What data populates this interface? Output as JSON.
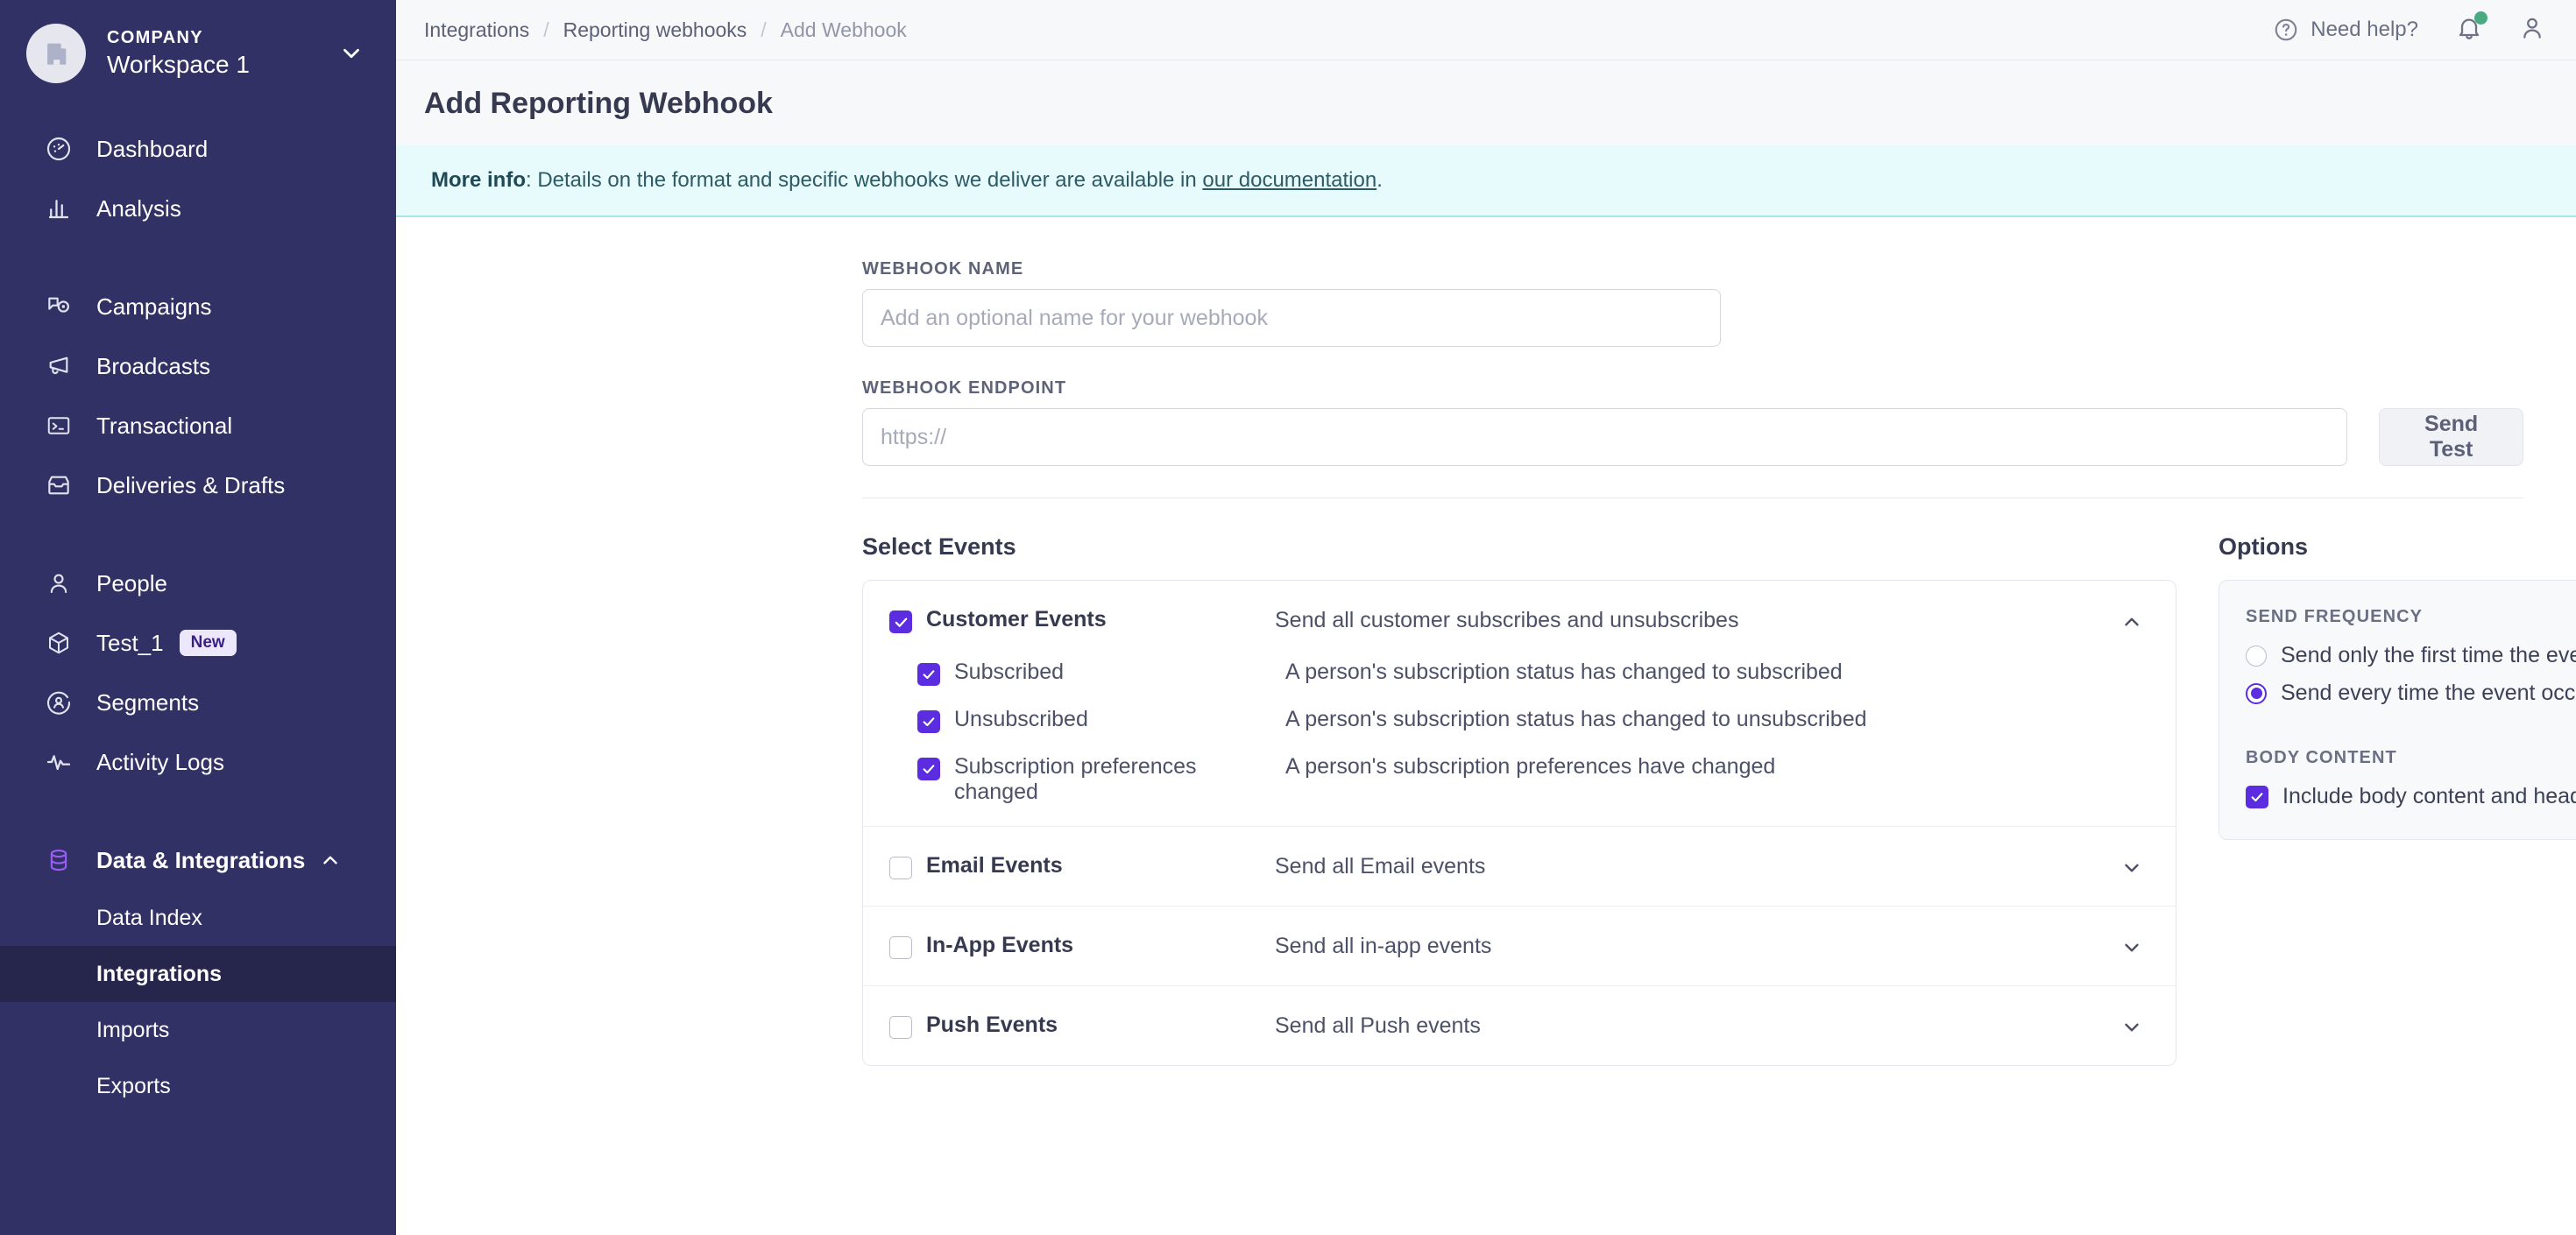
{
  "sidebar": {
    "workspace": {
      "company_label": "COMPANY",
      "name": "Workspace 1",
      "avatar_icon": "building-icon",
      "caret_icon": "chevron-down-icon"
    },
    "items": [
      {
        "label": "Dashboard",
        "icon": "gauge-icon"
      },
      {
        "label": "Analysis",
        "icon": "bar-chart-icon"
      },
      {
        "label": "Campaigns",
        "icon": "campaign-icon"
      },
      {
        "label": "Broadcasts",
        "icon": "megaphone-icon"
      },
      {
        "label": "Transactional",
        "icon": "terminal-icon"
      },
      {
        "label": "Deliveries & Drafts",
        "icon": "inbox-icon"
      },
      {
        "label": "People",
        "icon": "person-icon"
      },
      {
        "label": "Test_1",
        "icon": "cube-icon",
        "badge": "New"
      },
      {
        "label": "Segments",
        "icon": "segment-icon"
      },
      {
        "label": "Activity Logs",
        "icon": "pulse-icon"
      },
      {
        "label": "Data & Integrations",
        "icon": "database-icon",
        "expanded": true,
        "caret_icon": "chevron-up-icon"
      }
    ],
    "subitems": [
      {
        "label": "Data Index",
        "active": false
      },
      {
        "label": "Integrations",
        "active": true
      },
      {
        "label": "Imports",
        "active": false
      },
      {
        "label": "Exports",
        "active": false
      }
    ]
  },
  "topbar": {
    "breadcrumbs": [
      {
        "label": "Integrations"
      },
      {
        "label": "Reporting webhooks"
      },
      {
        "label": "Add Webhook"
      }
    ],
    "separator": "/",
    "need_help": "Need help?",
    "help_icon": "question-circle-icon",
    "bell_icon": "bell-icon",
    "bell_dot_color": "#4aaa82",
    "avatar_icon": "user-icon"
  },
  "page": {
    "title": "Add Reporting Webhook"
  },
  "banner": {
    "lead": "More info",
    "text_before": ": Details on the format and specific webhooks we deliver are available in ",
    "link": "our documentation",
    "text_after": "."
  },
  "form": {
    "webhook_name": {
      "label": "WEBHOOK NAME",
      "placeholder": "Add an optional name for your webhook",
      "value": ""
    },
    "webhook_endpoint": {
      "label": "WEBHOOK ENDPOINT",
      "placeholder": "https://",
      "value": ""
    },
    "send_test_label": "Send Test"
  },
  "events": {
    "section_title": "Select Events",
    "groups": [
      {
        "name": "Customer Events",
        "description": "Send all customer subscribes and unsubscribes",
        "checked": true,
        "expanded": true,
        "chevron_icon": "chevron-up-icon",
        "children": [
          {
            "name": "Subscribed",
            "description": "A person's subscription status has changed to subscribed",
            "checked": true
          },
          {
            "name": "Unsubscribed",
            "description": "A person's subscription status has changed to unsubscribed",
            "checked": true
          },
          {
            "name": "Subscription preferences changed",
            "description": "A person's subscription preferences have changed",
            "checked": true
          }
        ]
      },
      {
        "name": "Email Events",
        "description": "Send all Email events",
        "checked": false,
        "expanded": false,
        "chevron_icon": "chevron-down-icon",
        "children": []
      },
      {
        "name": "In-App Events",
        "description": "Send all in-app events",
        "checked": false,
        "expanded": false,
        "chevron_icon": "chevron-down-icon",
        "children": []
      },
      {
        "name": "Push Events",
        "description": "Send all Push events",
        "checked": false,
        "expanded": false,
        "chevron_icon": "chevron-down-icon",
        "children": []
      }
    ]
  },
  "options": {
    "section_title": "Options",
    "send_frequency": {
      "label": "SEND FREQUENCY",
      "choices": [
        {
          "label": "Send only the first time the event occurs",
          "selected": false
        },
        {
          "label": "Send every time the event occurs",
          "selected": true
        }
      ]
    },
    "body_content": {
      "label": "BODY CONTENT",
      "checkbox_label": "Include body content and headers in all Sent events",
      "checked": true
    }
  },
  "colors": {
    "sidebar_bg": "#313166",
    "sidebar_active_bg": "#26264d",
    "accent_purple": "#5b2ce0",
    "banner_bg": "#e7fafc",
    "header_bg": "#f7f8fa"
  }
}
